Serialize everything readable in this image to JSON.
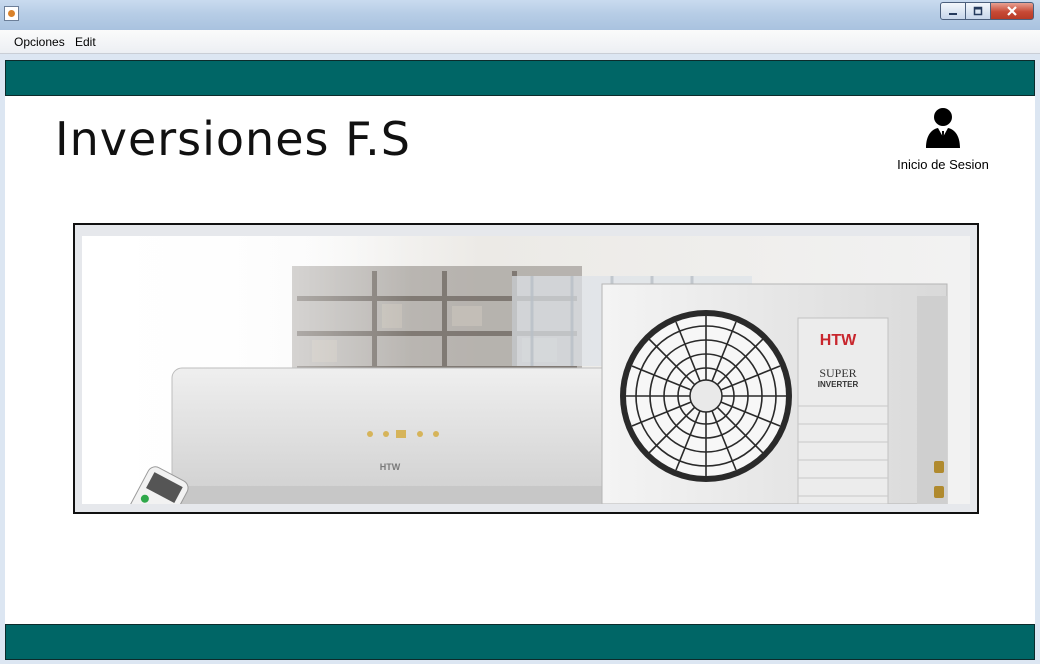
{
  "menu": {
    "items": [
      "Opciones",
      "Edit"
    ]
  },
  "header": {
    "brand": "Inversiones F.S",
    "login_label": "Inicio de Sesion"
  },
  "banner": {
    "indoor_logo": "HTW",
    "outdoor_logo": "HTW",
    "outdoor_line1": "SUPER",
    "outdoor_line2": "INVERTER"
  },
  "icons": {
    "app": "java-cup-icon",
    "user": "user-icon",
    "minimize": "minimize-icon",
    "maximize": "maximize-icon",
    "close": "close-icon"
  },
  "colors": {
    "bar": "#006666",
    "background": "#ffffff"
  }
}
